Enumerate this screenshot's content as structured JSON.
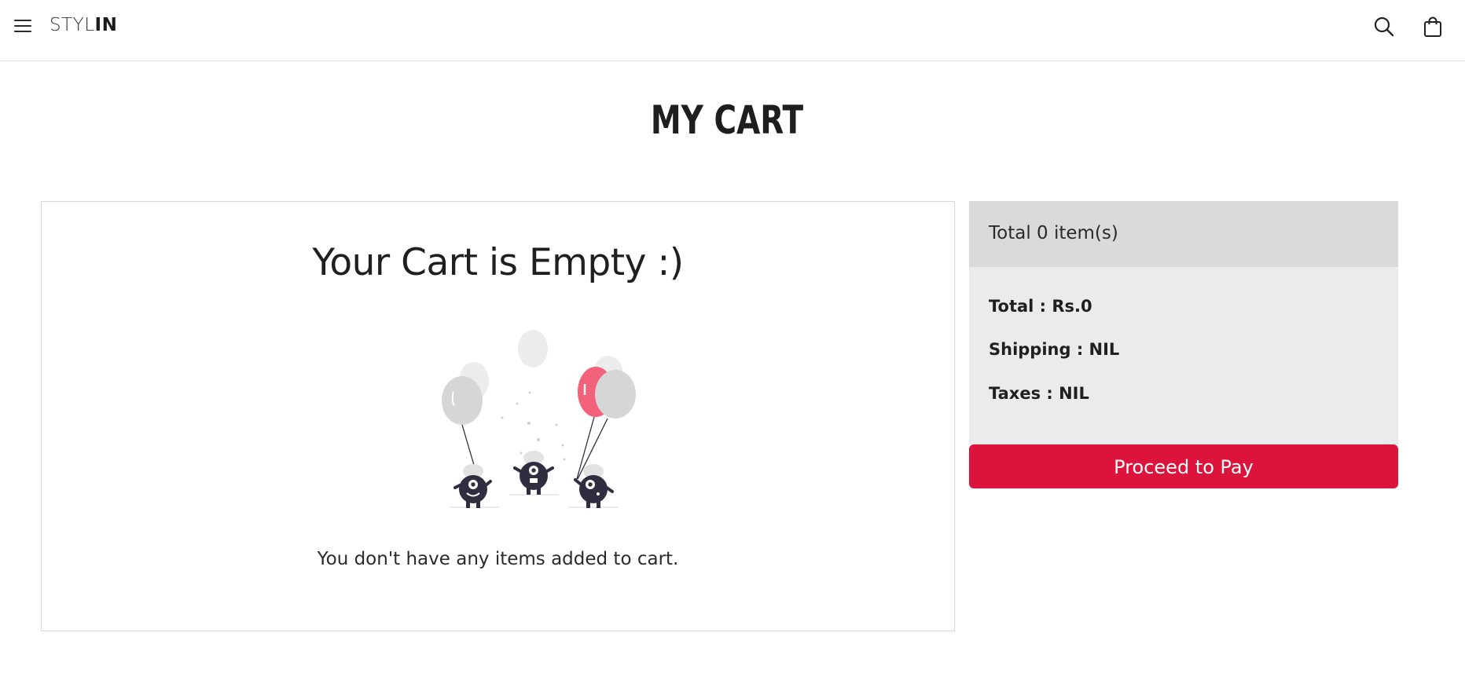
{
  "navbar": {
    "brand_light": "STYL",
    "brand_bold": "IN",
    "icons": [
      "menu-icon",
      "search-icon",
      "shopping-bag-icon"
    ]
  },
  "page": {
    "title": "MY CART"
  },
  "empty_cart": {
    "heading": "Your Cart is Empty :)",
    "message": "You don't have any items added to cart.",
    "illustration": "balloon-monsters-illustration"
  },
  "summary": {
    "header": "Total 0 item(s)",
    "total": "Total : Rs.0",
    "shipping": "Shipping : NIL",
    "taxes": "Taxes : NIL",
    "button_label": "Proceed to Pay"
  },
  "colors": {
    "accent": "#dc143c",
    "balloon_pink": "#f2627a",
    "balloon_grey": "#d6d6d6",
    "monster": "#2f2e41",
    "summary_bg": "#ebebeb",
    "summary_header_bg": "#dadada"
  }
}
